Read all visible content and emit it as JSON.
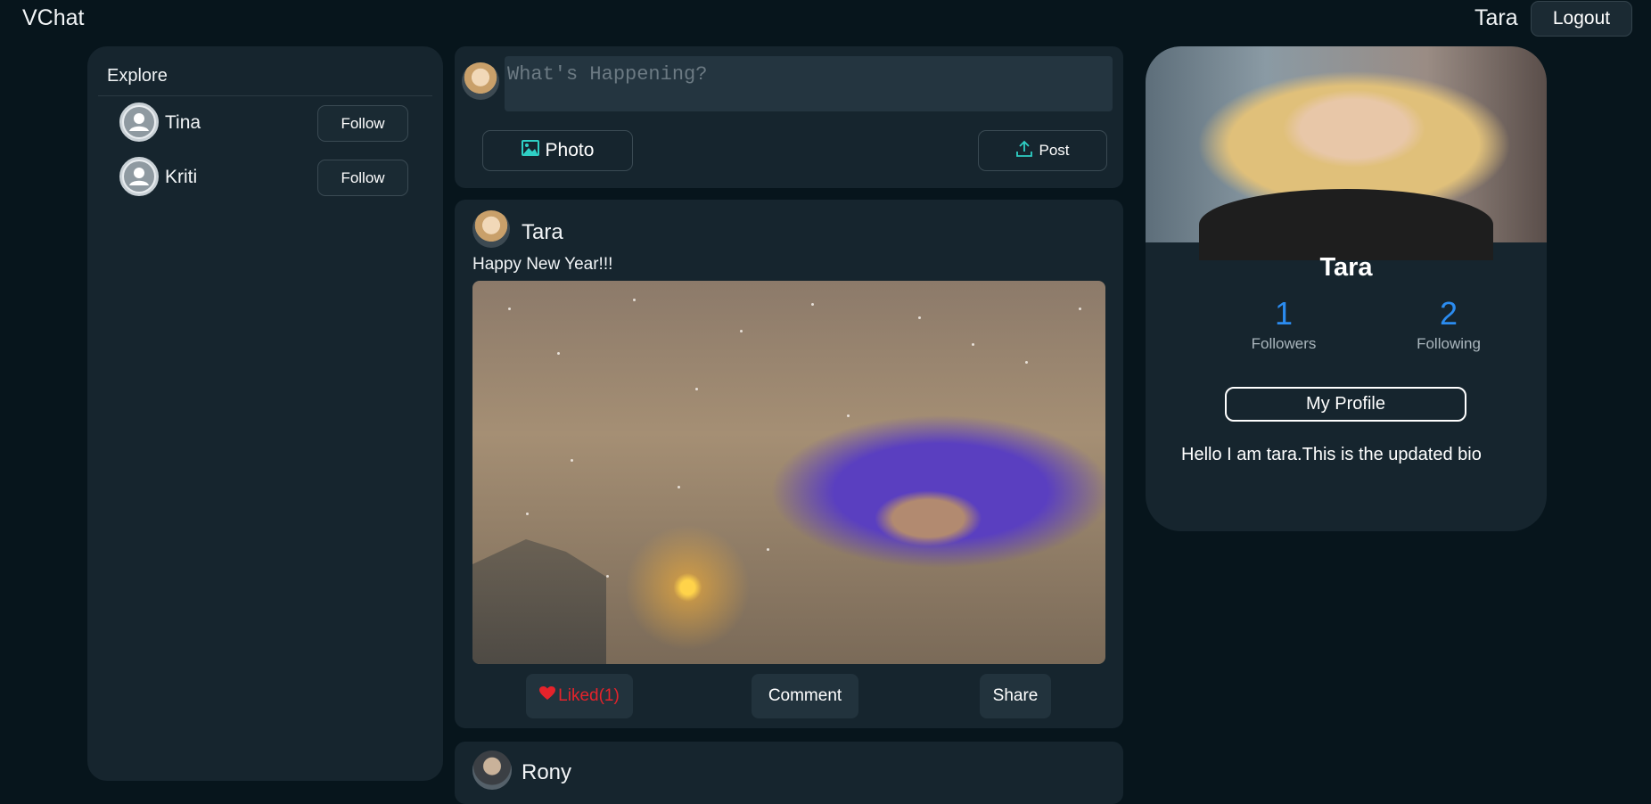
{
  "header": {
    "brand": "VChat",
    "username": "Tara",
    "logout_label": "Logout"
  },
  "explore": {
    "title": "Explore",
    "users": [
      {
        "name": "Tina",
        "button": "Follow"
      },
      {
        "name": "Kriti",
        "button": "Follow"
      }
    ]
  },
  "composer": {
    "placeholder": "What's Happening?",
    "photo_label": "Photo",
    "post_label": "Post"
  },
  "feed": {
    "posts": [
      {
        "author": "Tara",
        "text": "Happy New Year!!!",
        "like_label": "Liked(1)",
        "comment_label": "Comment",
        "share_label": "Share"
      },
      {
        "author": "Rony"
      }
    ]
  },
  "profile": {
    "name": "Tara",
    "followers_count": "1",
    "followers_label": "Followers",
    "following_count": "2",
    "following_label": "Following",
    "my_profile_label": "My Profile",
    "bio": "Hello I am tara.This is the updated bio"
  },
  "colors": {
    "background": "#07151c",
    "card": "#16252e",
    "accent_blue": "#2b8cf0",
    "liked_red": "#e5232b"
  }
}
